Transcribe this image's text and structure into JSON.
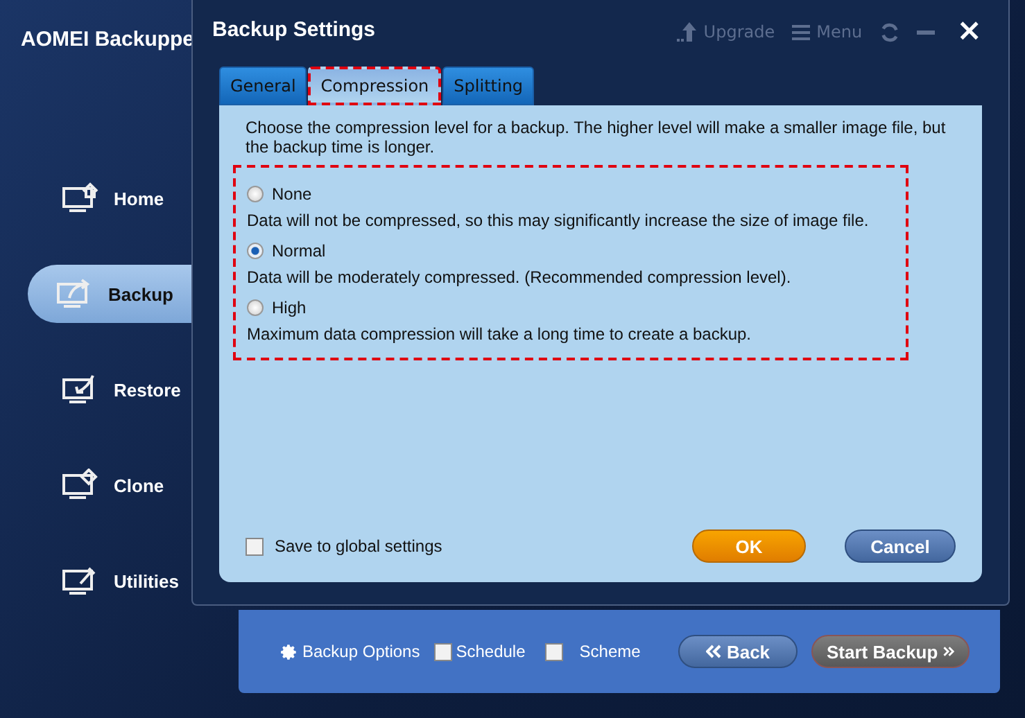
{
  "app": {
    "title": "AOMEI Backuppe"
  },
  "toolbar": {
    "upgrade": "Upgrade",
    "menu": "Menu",
    "close": "×"
  },
  "sidebar": {
    "items": [
      {
        "label": "Home",
        "kind": "home",
        "selected": false
      },
      {
        "label": "Backup",
        "kind": "backup",
        "selected": true
      },
      {
        "label": "Restore",
        "kind": "restore",
        "selected": false
      },
      {
        "label": "Clone",
        "kind": "clone",
        "selected": false
      },
      {
        "label": "Utilities",
        "kind": "utilities",
        "selected": false
      }
    ]
  },
  "bottom_bar": {
    "options": "Backup Options",
    "schedule": {
      "label": "Schedule",
      "checked": false
    },
    "scheme": {
      "label": "Scheme",
      "checked": false
    },
    "back": "Back",
    "start": "Start Backup"
  },
  "dialog": {
    "title": "Backup Settings",
    "tabs": [
      {
        "label": "General",
        "selected": false
      },
      {
        "label": "Compression",
        "selected": true
      },
      {
        "label": "Splitting",
        "selected": false
      }
    ],
    "intro": "Choose the compression level for a backup. The higher level will make a smaller image file, but the backup time is longer.",
    "options": [
      {
        "label": "None",
        "description": "Data will not be compressed, so this may significantly increase the size of image file.",
        "selected": false
      },
      {
        "label": "Normal",
        "description": "Data will be moderately compressed. (Recommended compression level).",
        "selected": true
      },
      {
        "label": "High",
        "description": "Maximum data compression will take a long time to create a backup.",
        "selected": false
      }
    ],
    "save_global": {
      "label": "Save to global settings",
      "checked": false
    },
    "ok": "OK",
    "cancel": "Cancel"
  }
}
